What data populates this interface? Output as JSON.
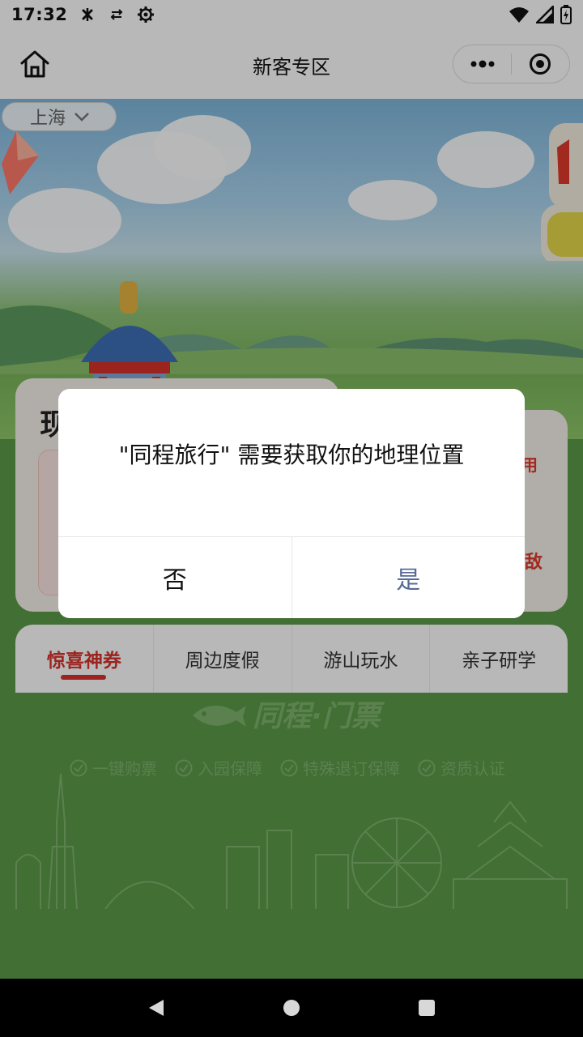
{
  "status_bar": {
    "time": "17:32",
    "left_icons": [
      "bluetooth-off-icon",
      "data-saver-icon",
      "settings-gear-icon"
    ],
    "right_icons": [
      "wifi-icon",
      "cell-signal-icon",
      "battery-charging-icon"
    ]
  },
  "nav": {
    "title": "新客专区",
    "home_icon": "home-icon",
    "more_icon": "more-dots-icon",
    "close_icon": "miniprogram-close-icon"
  },
  "hero": {
    "city": "上海"
  },
  "cards": {
    "left_title": "现",
    "right_tag_1": "用",
    "right_tag_2": "敌"
  },
  "tabs": [
    {
      "label": "惊喜神券",
      "active": true
    },
    {
      "label": "周边度假",
      "active": false
    },
    {
      "label": "游山玩水",
      "active": false
    },
    {
      "label": "亲子研学",
      "active": false
    }
  ],
  "brand": {
    "name": "同程·门票",
    "badges": [
      "一键购票",
      "入园保障",
      "特殊退订保障",
      "资质认证"
    ]
  },
  "dialog": {
    "message": "\"同程旅行\" 需要获取你的地理位置",
    "no_label": "否",
    "yes_label": "是"
  },
  "colors": {
    "accent_red": "#d9332b",
    "dialog_confirm": "#576b95",
    "page_green": "#5a9a48"
  }
}
